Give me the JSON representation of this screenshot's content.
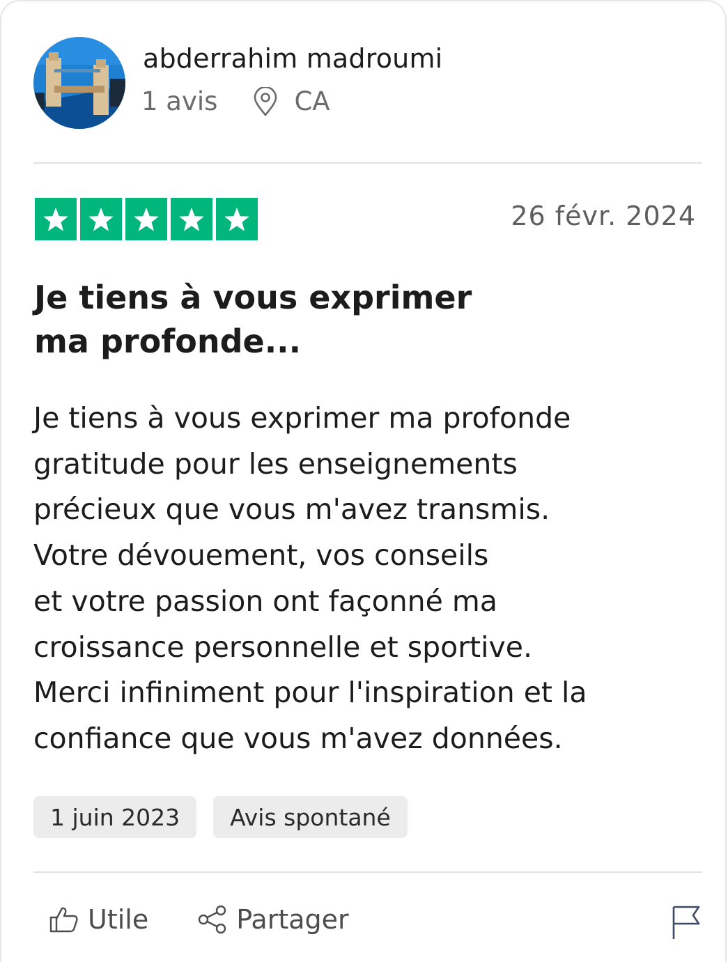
{
  "reviewer": {
    "name": "abderrahim madroumi",
    "review_count": "1 avis",
    "country": "CA"
  },
  "review": {
    "rating": 5,
    "rating_max": 5,
    "star_color": "#00b67a",
    "date": "26 févr. 2024",
    "title_lines": [
      "Je tiens à vous exprimer",
      "ma profonde..."
    ],
    "body_lines": [
      "Je tiens à vous exprimer ma profonde",
      "gratitude pour les enseignements",
      "précieux que vous m'avez transmis.",
      "Votre dévouement, vos conseils",
      "et votre passion ont façonné ma",
      "croissance personnelle et sportive.",
      "Merci infiniment pour l'inspiration et la",
      "confiance que vous m'avez données."
    ]
  },
  "tags": [
    "1 juin 2023",
    "Avis spontané"
  ],
  "actions": {
    "useful_label": "Utile",
    "share_label": "Partager"
  },
  "icons": {
    "location": "location-pin-icon",
    "useful": "thumbs-up-icon",
    "share": "share-icon",
    "report": "flag-icon"
  }
}
